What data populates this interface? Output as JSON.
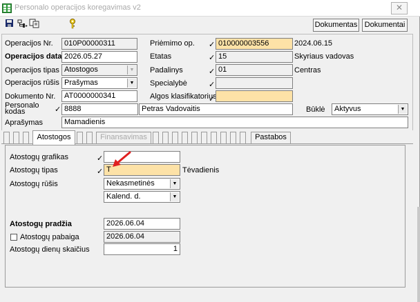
{
  "window": {
    "title": "Personalo operacijos koregavimas v2",
    "close_glyph": "✕",
    "app_icon": "spreadsheet-app-icon"
  },
  "toolbar": {
    "icons": [
      "save-icon",
      "hierarchy-icon",
      "copy-icon",
      "key-icon"
    ],
    "buttons": {
      "dokumentas": "Dokumentas",
      "dokumentai": "Dokumentai"
    }
  },
  "header": {
    "operacijos_nr": {
      "label": "Operacijos Nr.",
      "value": "010P00000311"
    },
    "operacijos_data": {
      "label": "Operacijos data",
      "value": "2026.05.27"
    },
    "operacijos_tipas": {
      "label": "Operacijos tipas",
      "value": "Atostogos"
    },
    "operacijos_rusis": {
      "label": "Operacijos rūšis",
      "value": "Prašymas"
    },
    "dokumento_nr": {
      "label": "Dokumento Nr.",
      "value": "AT0000000341"
    },
    "personalo_kodas": {
      "label_line1": "Personalo",
      "label_line2": "kodas",
      "code": "8888",
      "name": "Petras Vadovaitis"
    },
    "aprasymas": {
      "label": "Aprašymas",
      "value": "Mamadienis"
    },
    "priemimo_op": {
      "label": "Priėmimo op.",
      "value": "010000003556",
      "date": "2024.06.15"
    },
    "etatas": {
      "label": "Etatas",
      "value": "15",
      "description": "Skyriaus vadovas"
    },
    "padalinys": {
      "label": "Padalinys",
      "value": "01",
      "description": "Centras"
    },
    "specialybe": {
      "label": "Specialybė",
      "value": ""
    },
    "algos_klasifikatorius": {
      "label": "Algos klasifikatorius",
      "value": ""
    },
    "bukle": {
      "label": "Būklė",
      "value": "Aktyvus"
    }
  },
  "check_glyph": "✓",
  "dropdown_glyph": "▼",
  "tabs": {
    "atostogos": "Atostogos",
    "finansavimas": "Finansavimas",
    "pastabos": "Pastabos"
  },
  "vacation": {
    "grafikas": {
      "label": "Atostogų grafikas",
      "value": ""
    },
    "tipas": {
      "label": "Atostogų tipas",
      "value": "T",
      "description": "Tėvadienis"
    },
    "rusis": {
      "label": "Atostogų rūšis",
      "value": "Nekasmetinės",
      "day_type": "Kalend. d."
    },
    "pradzia": {
      "label": "Atostogų pradžia",
      "value": "2026.06.04"
    },
    "pabaiga": {
      "label": "Atostogų pabaiga",
      "value": "2026.06.04",
      "checked": false
    },
    "dienu_skaicius": {
      "label": "Atostogų dienų skaičius",
      "value": "1"
    }
  },
  "colors": {
    "required_field": "#fde2a7",
    "annotation_arrow": "#e02020"
  }
}
